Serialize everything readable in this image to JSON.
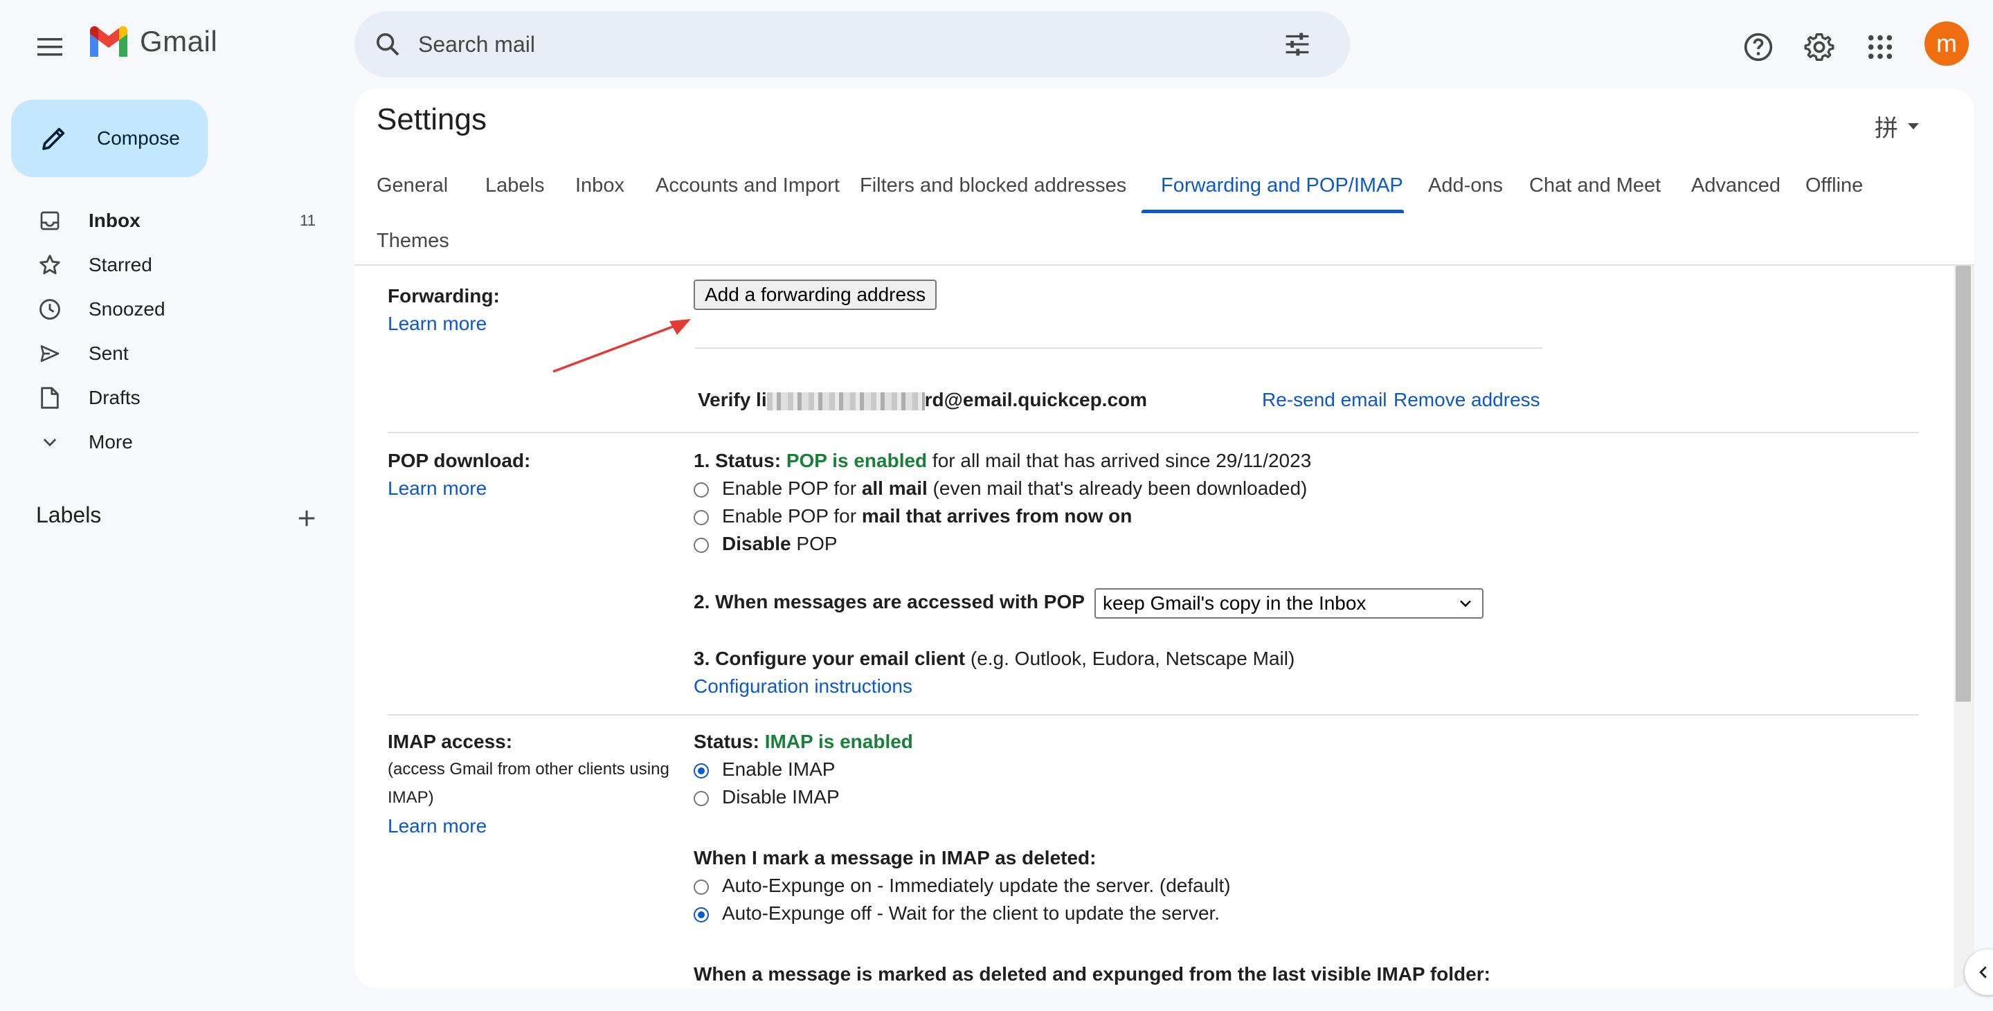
{
  "app": {
    "name": "Gmail"
  },
  "search": {
    "placeholder": "Search mail"
  },
  "user": {
    "avatar_letter": "m",
    "avatar_color": "#f06d10"
  },
  "compose": {
    "label": "Compose"
  },
  "nav": [
    {
      "label": "Inbox",
      "count": "11",
      "icon": "inbox-icon",
      "bold": true
    },
    {
      "label": "Starred",
      "count": "",
      "icon": "star-icon"
    },
    {
      "label": "Snoozed",
      "count": "",
      "icon": "clock-icon"
    },
    {
      "label": "Sent",
      "count": "",
      "icon": "send-icon"
    },
    {
      "label": "Drafts",
      "count": "",
      "icon": "draft-icon"
    },
    {
      "label": "More",
      "count": "",
      "icon": "chevron-down-icon"
    }
  ],
  "labels_section": {
    "title": "Labels"
  },
  "settings": {
    "title": "Settings",
    "input_tool": "拼",
    "tabs": [
      {
        "label": "General"
      },
      {
        "label": "Labels"
      },
      {
        "label": "Inbox"
      },
      {
        "label": "Accounts and Import"
      },
      {
        "label": "Filters and blocked addresses"
      },
      {
        "label": "Forwarding and POP/IMAP",
        "active": true
      },
      {
        "label": "Add-ons"
      },
      {
        "label": "Chat and Meet"
      },
      {
        "label": "Advanced"
      },
      {
        "label": "Offline"
      },
      {
        "label": "Themes"
      }
    ]
  },
  "forwarding": {
    "label": "Forwarding:",
    "learn_more": "Learn more",
    "add_button": "Add a forwarding address",
    "verify_prefix": "Verify li",
    "verify_suffix": "rd@email.quickcep.com",
    "resend": "Re-send email",
    "remove": "Remove address"
  },
  "pop": {
    "label": "POP download:",
    "learn_more": "Learn more",
    "status_prefix": "1. Status: ",
    "status_value": "POP is enabled",
    "status_suffix": " for all mail that has arrived since 29/11/2023",
    "options": [
      {
        "pre": "Enable POP for ",
        "bold": "all mail",
        "post": " (even mail that's already been downloaded)",
        "checked": false
      },
      {
        "pre": "Enable POP for ",
        "bold": "mail that arrives from now on",
        "post": "",
        "checked": false
      },
      {
        "pre": "",
        "bold": "Disable",
        "post": " POP",
        "checked": false
      }
    ],
    "access_label": "2. When messages are accessed with POP",
    "access_select": "keep Gmail's copy in the Inbox",
    "configure_label": "3. Configure your email client",
    "configure_hint": " (e.g. Outlook, Eudora, Netscape Mail)",
    "config_link": "Configuration instructions"
  },
  "imap": {
    "label": "IMAP access:",
    "sublabel": "(access Gmail from other clients using IMAP)",
    "learn_more": "Learn more",
    "status_prefix": "Status: ",
    "status_value": "IMAP is enabled",
    "options": [
      {
        "label": "Enable IMAP",
        "checked": true
      },
      {
        "label": "Disable IMAP",
        "checked": false
      }
    ],
    "deleted_heading": "When I mark a message in IMAP as deleted:",
    "deleted_options": [
      {
        "label": "Auto-Expunge on - Immediately update the server. (default)",
        "checked": false
      },
      {
        "label": "Auto-Expunge off - Wait for the client to update the server.",
        "checked": true
      }
    ],
    "expunged_heading": "When a message is marked as deleted and expunged from the last visible IMAP folder:"
  },
  "colors": {
    "accent": "#0b57d0",
    "status_green": "#188038",
    "annotation_arrow": "#e53935"
  }
}
